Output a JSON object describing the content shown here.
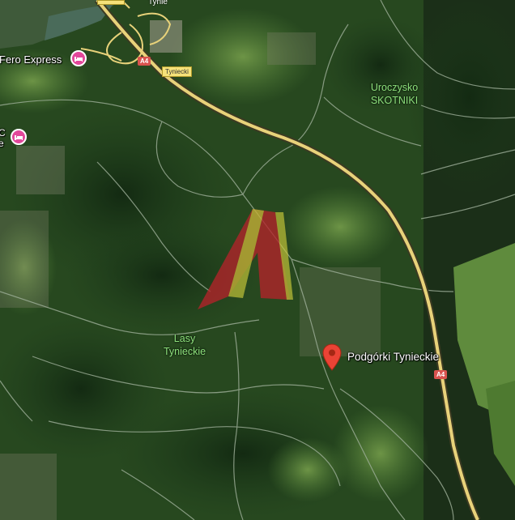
{
  "map": {
    "labels": {
      "hotel_1": "Fero Express",
      "hotel_2_partial_top": "C",
      "hotel_2_partial_bottom": "e",
      "forest_north_line1": "Uroczysko",
      "forest_north_line2": "SKOTNIKI",
      "forest_south_line1": "Lasy",
      "forest_south_line2": "Tynieckie",
      "village": "Podgórki Tynieckie",
      "top_street": "Tynie"
    },
    "road_shields": {
      "a4_north": "A4",
      "a4_south": "A4"
    },
    "road_names": {
      "tyniecki": "Tyniecki"
    },
    "icons": {
      "hotel": "hotel-bed-icon",
      "place": "location-pin-icon"
    },
    "colors": {
      "forest_dark": "#1c3a1a",
      "forest_mid": "#2f5a26",
      "field_light": "#5f8a3e",
      "motorway": "#e8d27a",
      "parcel_fill": "#c8232c",
      "parcel_stripe": "#c9c93a",
      "pin": "#ea4335",
      "hotel": "#e2479a"
    }
  }
}
